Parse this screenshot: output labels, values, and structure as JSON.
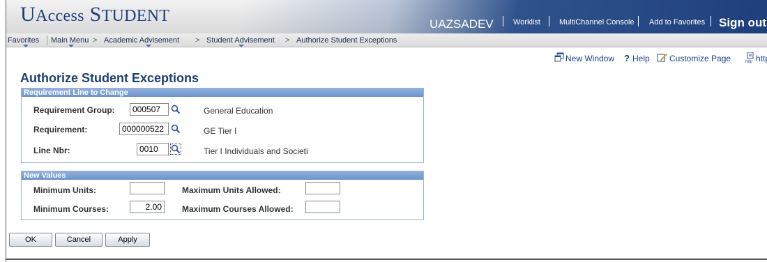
{
  "header": {
    "logo_u": "U",
    "logo_access": "Access",
    "logo_student_s": "S",
    "logo_student_rest": "TUDENT",
    "environment": "UAZSADEV",
    "nav": [
      "Worklist",
      "MultiChannel Console",
      "Add to Favorites"
    ],
    "sign_out": "Sign out"
  },
  "breadcrumb": {
    "items": [
      "Favorites",
      "Main Menu",
      "Academic Advisement",
      "Student Advisement",
      "Authorize Student Exceptions"
    ]
  },
  "page_tools": {
    "new_window": "New Window",
    "help": "Help",
    "customize_page": "Customize Page",
    "http": "http"
  },
  "page_title": "Authorize Student Exceptions",
  "requirement_line": {
    "heading": "Requirement Line to Change",
    "requirement_group": {
      "label": "Requirement Group:",
      "value": "000507",
      "description": "General Education"
    },
    "requirement": {
      "label": "Requirement:",
      "value": "000000522",
      "description": "GE Tier I"
    },
    "line_nbr": {
      "label": "Line Nbr:",
      "value": "0010",
      "description": "Tier I Individuals and Societi"
    }
  },
  "new_values": {
    "heading": "New Values",
    "minimum_units": {
      "label": "Minimum Units:",
      "value": ""
    },
    "maximum_units": {
      "label": "Maximum Units Allowed:",
      "value": ""
    },
    "minimum_courses": {
      "label": "Minimum Courses:",
      "value": "2.00"
    },
    "maximum_courses": {
      "label": "Maximum Courses Allowed:",
      "value": ""
    }
  },
  "buttons": {
    "ok": "OK",
    "cancel": "Cancel",
    "apply": "Apply"
  },
  "colors": {
    "brand_navy": "#1f3f7d",
    "group_header": "#7b9fd3",
    "link_blue": "#1c3f88"
  }
}
